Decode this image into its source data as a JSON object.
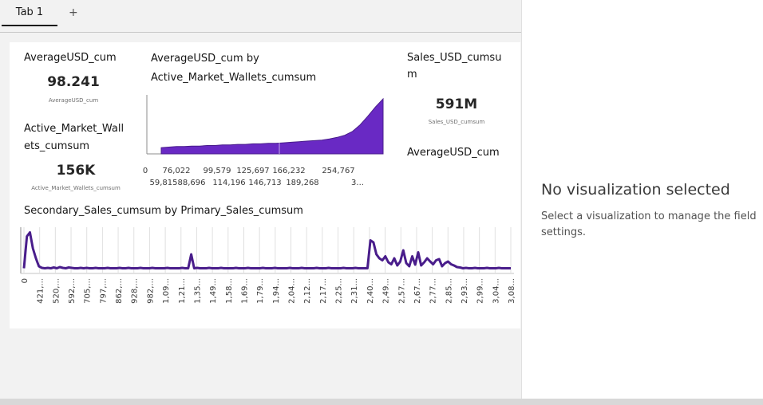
{
  "tabs": {
    "items": [
      {
        "label": "Tab 1"
      }
    ],
    "add_label": "+"
  },
  "widgets": {
    "kpi1": {
      "title": "AverageUSD_cum",
      "value": "98.241",
      "caption": "AverageUSD_cum"
    },
    "kpi2": {
      "title_line1": "Active_Market_Wall",
      "title_line2": "ets_cumsum",
      "value": "156K",
      "caption": "Active_Market_Wallets_cumsum"
    },
    "kpi3": {
      "title_line1": "Sales_USD_cumsu",
      "title_line2": "m",
      "value": "591M",
      "caption": "Sales_USD_cumsum"
    },
    "kpi4": {
      "title": "AverageUSD_cum"
    },
    "area": {
      "title_line1": "AverageUSD_cum by",
      "title_line2": "Active_Market_Wallets_cumsum"
    },
    "line": {
      "title": "Secondary_Sales_cumsum by Primary_Sales_cumsum"
    }
  },
  "right_panel": {
    "title": "No visualization selected",
    "text": "Select a visualization to manage the field settings."
  },
  "colors": {
    "accent": "#6929c4",
    "line": "#491d8b"
  },
  "chart_data": [
    {
      "type": "area",
      "x_ticks_row1": [
        "0",
        "76,022",
        "99,579",
        "125,697",
        "166,232",
        "254,767"
      ],
      "x_ticks_row2": [
        "59,815",
        "88,696",
        "114,196",
        "146,713",
        "189,268",
        "3..."
      ],
      "y": [
        0.1,
        0.11,
        0.12,
        0.12,
        0.13,
        0.13,
        0.14,
        0.14,
        0.15,
        0.15,
        0.16,
        0.16,
        0.17,
        0.17,
        0.18,
        0.18,
        0.19,
        0.2,
        0.21,
        0.22,
        0.23,
        0.24,
        0.26,
        0.29,
        0.33,
        0.4,
        0.52,
        0.68,
        0.85,
        1.0
      ]
    },
    {
      "type": "line",
      "x_ticks": [
        "0",
        "421,...",
        "520,...",
        "592,...",
        "705,...",
        "797,...",
        "862,...",
        "928,...",
        "982,...",
        "1,09...",
        "1,21...",
        "1,35...",
        "1,49...",
        "1,58...",
        "1,69...",
        "1,79...",
        "1,94...",
        "2,04...",
        "2,12...",
        "2,17...",
        "2,25...",
        "2,31...",
        "2,40...",
        "2,49...",
        "2,57...",
        "2,67...",
        "2,77...",
        "2,85...",
        "2,93...",
        "2,99...",
        "3,04...",
        "3,08..."
      ],
      "y": [
        0.05,
        0.85,
        0.95,
        0.55,
        0.3,
        0.1,
        0.06,
        0.05,
        0.06,
        0.05,
        0.07,
        0.05,
        0.08,
        0.06,
        0.05,
        0.07,
        0.06,
        0.05,
        0.05,
        0.06,
        0.05,
        0.06,
        0.05,
        0.05,
        0.06,
        0.05,
        0.05,
        0.05,
        0.06,
        0.05,
        0.05,
        0.05,
        0.06,
        0.05,
        0.05,
        0.06,
        0.05,
        0.05,
        0.05,
        0.06,
        0.05,
        0.05,
        0.05,
        0.06,
        0.05,
        0.05,
        0.05,
        0.05,
        0.06,
        0.05,
        0.05,
        0.05,
        0.05,
        0.06,
        0.05,
        0.05,
        0.4,
        0.05,
        0.06,
        0.05,
        0.05,
        0.05,
        0.06,
        0.05,
        0.05,
        0.05,
        0.06,
        0.05,
        0.05,
        0.05,
        0.05,
        0.06,
        0.05,
        0.05,
        0.05,
        0.06,
        0.05,
        0.05,
        0.05,
        0.05,
        0.06,
        0.05,
        0.05,
        0.05,
        0.06,
        0.05,
        0.05,
        0.05,
        0.05,
        0.06,
        0.05,
        0.05,
        0.05,
        0.06,
        0.05,
        0.05,
        0.05,
        0.05,
        0.06,
        0.05,
        0.05,
        0.05,
        0.06,
        0.05,
        0.05,
        0.05,
        0.05,
        0.06,
        0.05,
        0.05,
        0.05,
        0.06,
        0.05,
        0.05,
        0.05,
        0.05,
        0.75,
        0.7,
        0.4,
        0.3,
        0.25,
        0.35,
        0.2,
        0.15,
        0.3,
        0.12,
        0.22,
        0.5,
        0.18,
        0.1,
        0.35,
        0.14,
        0.45,
        0.12,
        0.2,
        0.3,
        0.22,
        0.15,
        0.25,
        0.28,
        0.1,
        0.18,
        0.22,
        0.15,
        0.12,
        0.08,
        0.07,
        0.05,
        0.06,
        0.05,
        0.05,
        0.06,
        0.05,
        0.05,
        0.05,
        0.06,
        0.05,
        0.05,
        0.05,
        0.06,
        0.05,
        0.05,
        0.05,
        0.05
      ]
    }
  ]
}
